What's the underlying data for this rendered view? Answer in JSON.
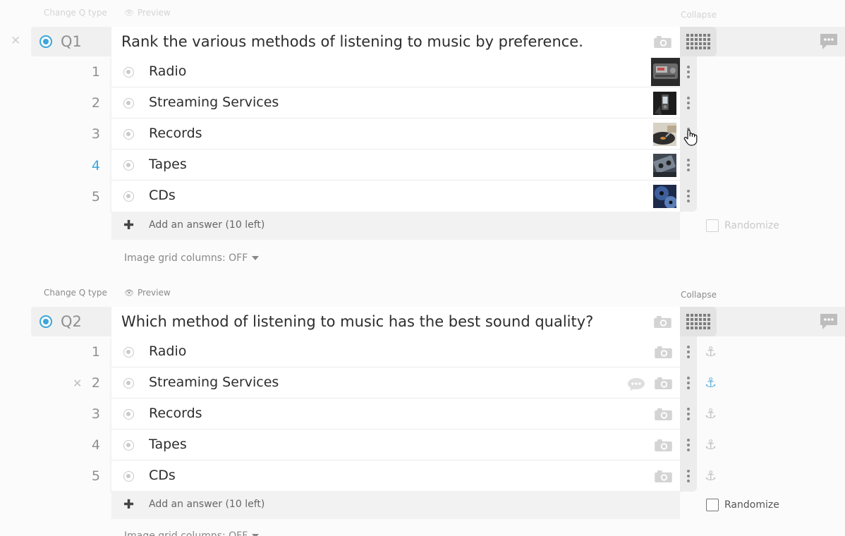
{
  "labels": {
    "change_q_type": "Change Q type",
    "preview": "Preview",
    "collapse": "Collapse",
    "add_answer": "Add an answer (10 left)",
    "randomize": "Randomize",
    "image_grid": "Image grid columns: OFF"
  },
  "q1": {
    "number": "Q1",
    "text": "Rank the various methods of listening to music by preference.",
    "answers": [
      {
        "num": "1",
        "label": "Radio"
      },
      {
        "num": "2",
        "label": "Streaming Services"
      },
      {
        "num": "3",
        "label": "Records"
      },
      {
        "num": "4",
        "label": "Tapes"
      },
      {
        "num": "5",
        "label": "CDs"
      }
    ]
  },
  "q2": {
    "number": "Q2",
    "text": "Which method of listening to music has the best sound quality?",
    "answers": [
      {
        "num": "1",
        "label": "Radio"
      },
      {
        "num": "2",
        "label": "Streaming Services"
      },
      {
        "num": "3",
        "label": "Records"
      },
      {
        "num": "4",
        "label": "Tapes"
      },
      {
        "num": "5",
        "label": "CDs"
      }
    ]
  },
  "colors": {
    "accent": "#3aa6da",
    "anchor_active": "#6fb6df"
  }
}
